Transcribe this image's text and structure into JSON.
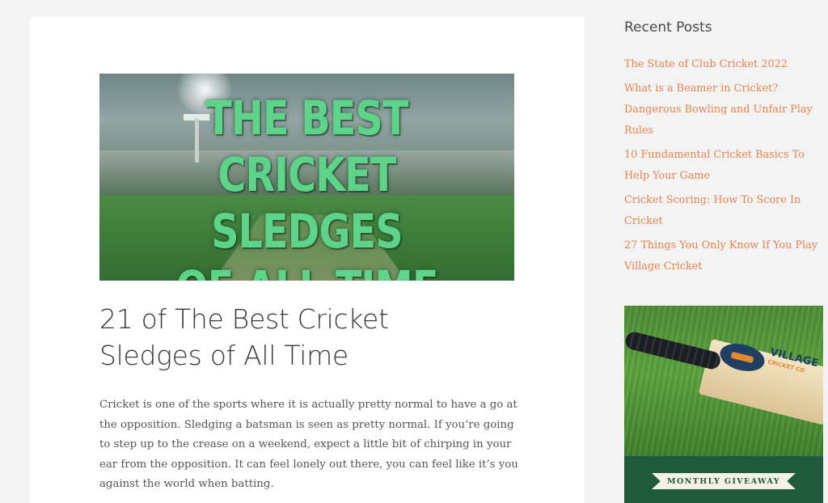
{
  "hero": {
    "line1": "THE BEST",
    "line2": "CRICKET SLEDGES",
    "line3": "OF ALL TIME"
  },
  "post": {
    "title_line1": "21 of The Best Cricket",
    "title_line2": "Sledges of All Time",
    "body": "Cricket is one of the sports where it is actually pretty normal to have a go at the opposition. Sledging a batsman is seen as pretty normal. If you’re going to step up to the crease on a weekend, expect a little bit of chirping in your ear from the opposition. It can feel lonely out there, you can feel like it’s you against the world when batting."
  },
  "sidebar": {
    "heading": "Recent Posts",
    "items": [
      {
        "label": "The State of Club Cricket 2022"
      },
      {
        "label": "What is a Beamer in Cricket? Dangerous Bowling and Unfair Play Rules"
      },
      {
        "label": "10 Fundamental Cricket Basics To Help Your Game"
      },
      {
        "label": "Cricket Scoring: How To Score In Cricket"
      },
      {
        "label": "27 Things You Only Know If You Play Village Cricket"
      }
    ]
  },
  "promo": {
    "logo_text": "VILLAGE",
    "logo_sub": "CRICKET CO",
    "ribbon": "MONTHLY GIVEAWAY"
  },
  "colors": {
    "link": "#e8834e",
    "hero_text": "#5ed38a",
    "promo_band": "#1f5a3b"
  }
}
